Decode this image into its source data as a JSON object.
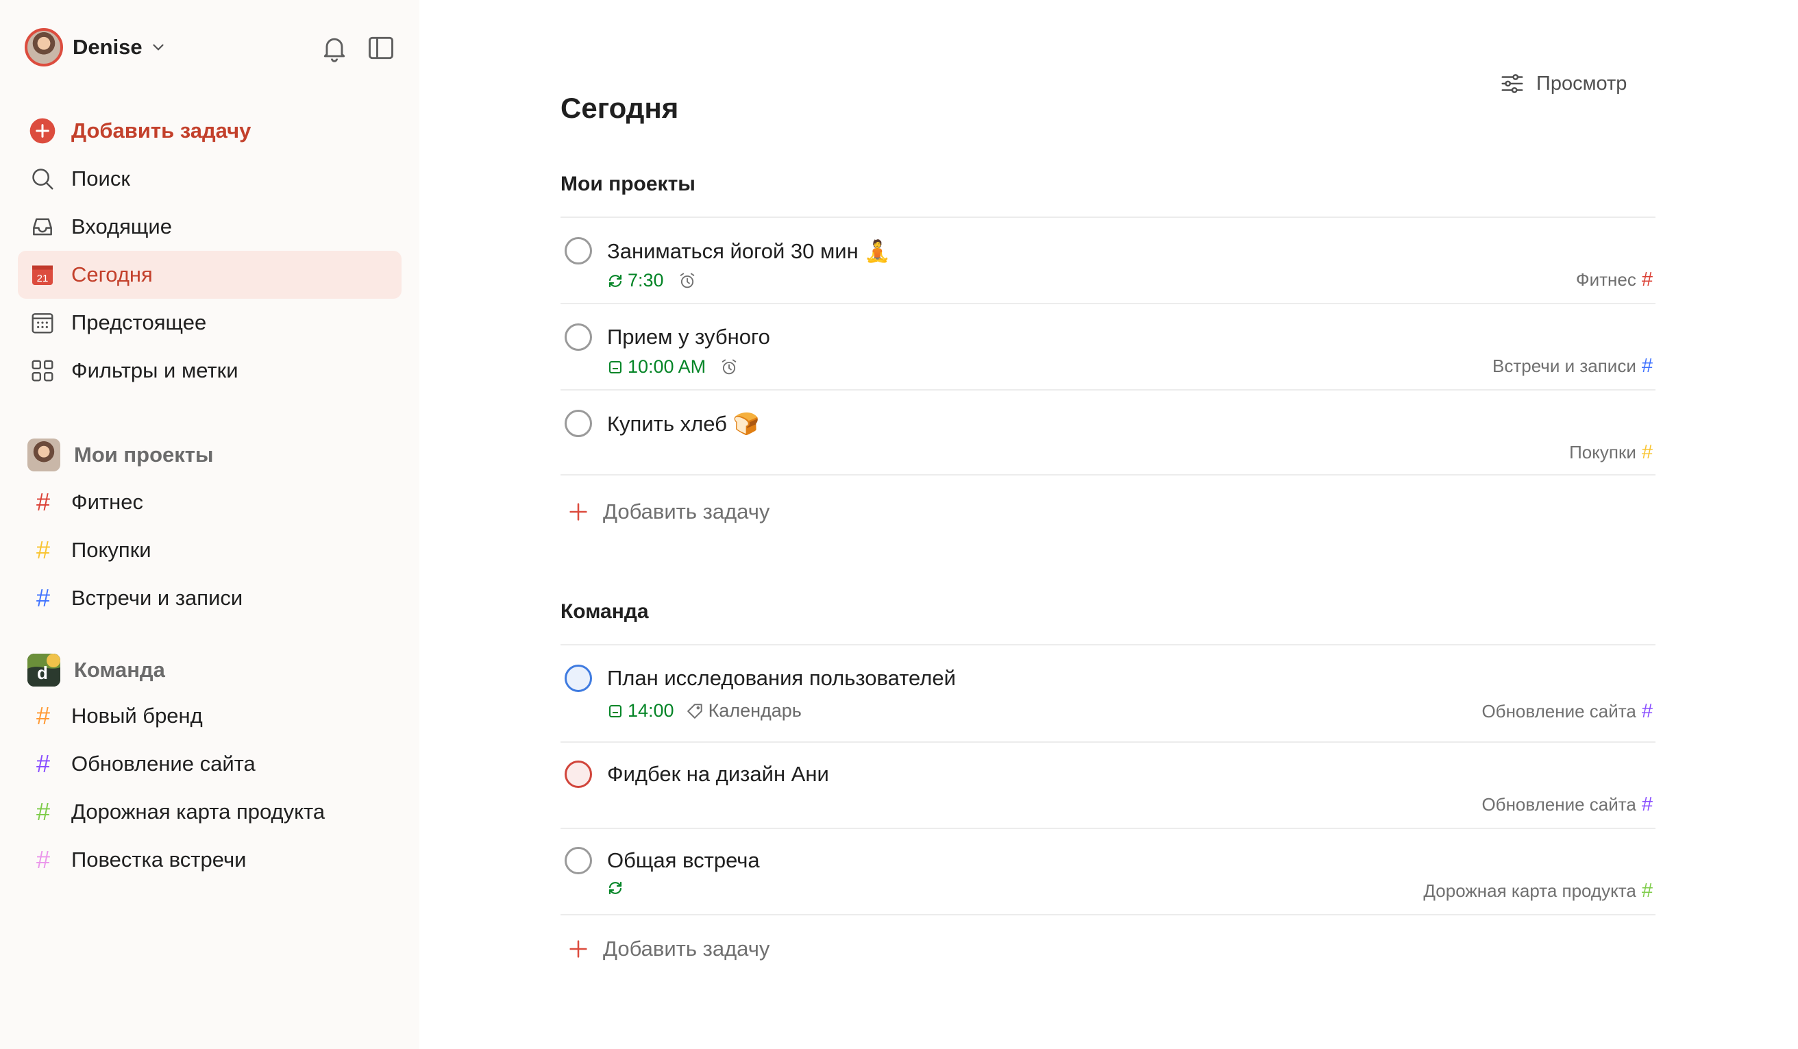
{
  "user": {
    "name": "Denise"
  },
  "icons": {
    "chevron": "chevron-down-icon",
    "bell": "bell-icon",
    "sidebar_toggle": "sidebar-toggle-icon"
  },
  "colors": {
    "accent": "#dc4c3e",
    "active_bg": "#fbe9e4",
    "green": "#058527",
    "fitness": "#db4035",
    "shopping": "#f9c431",
    "meetings": "#4073ff",
    "brand": "#ff9933",
    "site": "#884dff",
    "roadmap": "#7ecc49",
    "agenda": "#eb96eb"
  },
  "nav": {
    "add_task": "Добавить задачу",
    "search": "Поиск",
    "inbox": "Входящие",
    "today": "Сегодня",
    "today_badge": "21",
    "upcoming": "Предстоящее",
    "filters": "Фильтры и метки"
  },
  "my_projects": {
    "title": "Мои проекты",
    "items": [
      {
        "label": "Фитнес",
        "color": "#db4035"
      },
      {
        "label": "Покупки",
        "color": "#f9c431"
      },
      {
        "label": "Встречи и записи",
        "color": "#4073ff"
      }
    ]
  },
  "team": {
    "title": "Команда",
    "items": [
      {
        "label": "Новый бренд",
        "color": "#ff9933"
      },
      {
        "label": "Обновление сайта",
        "color": "#884dff"
      },
      {
        "label": "Дорожная карта продукта",
        "color": "#7ecc49"
      },
      {
        "label": "Повестка встречи",
        "color": "#eb96eb"
      }
    ]
  },
  "main": {
    "view_label": "Просмотр",
    "title": "Сегодня",
    "hash": "#",
    "add_task": "Добавить задачу",
    "groups": [
      {
        "title": "Мои проекты",
        "tasks": [
          {
            "title": "Заниматься йогой 30 мин 🧘",
            "time": "7:30",
            "project": "Фитнес"
          },
          {
            "title": "Прием у зубного",
            "time": "10:00 AM",
            "project": "Встречи и записи"
          },
          {
            "title": "Купить хлеб 🍞",
            "project": "Покупки"
          }
        ]
      },
      {
        "title": "Команда",
        "tasks": [
          {
            "title": "План исследования пользователей",
            "time": "14:00",
            "label": "Календарь",
            "project": "Обновление сайта"
          },
          {
            "title": "Фидбек на дизайн Ани",
            "project": "Обновление сайта"
          },
          {
            "title": "Общая встреча",
            "project": "Дорожная карта продукта"
          }
        ]
      }
    ]
  }
}
